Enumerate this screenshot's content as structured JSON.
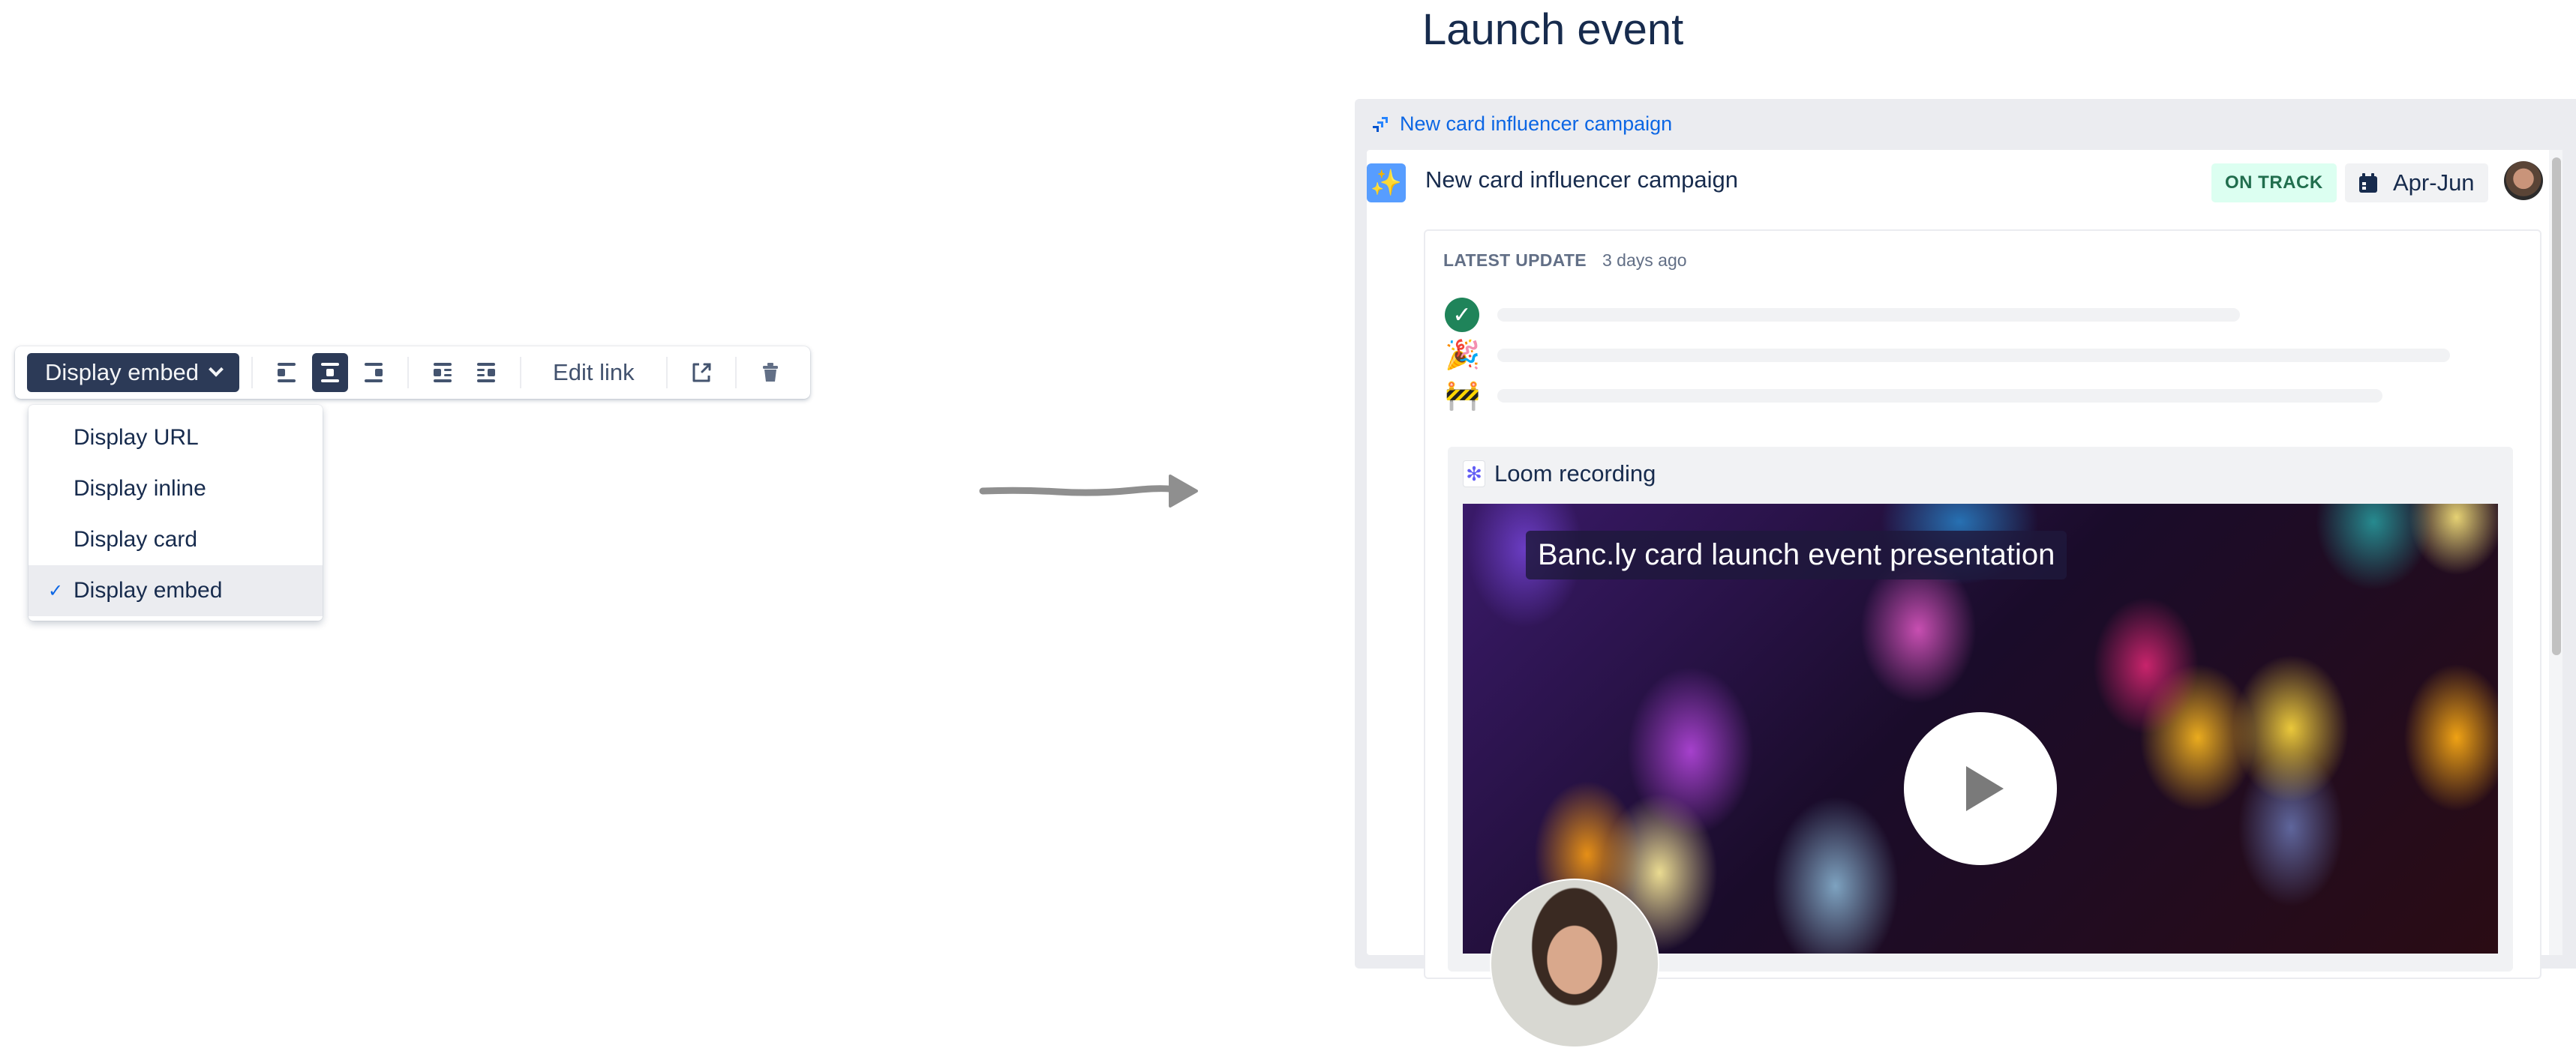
{
  "toolbar": {
    "appearance_label": "Display embed",
    "alignment_buttons": [
      {
        "icon": "align-left-icon",
        "active": false
      },
      {
        "icon": "align-center-icon",
        "active": true
      },
      {
        "icon": "align-right-icon",
        "active": false
      }
    ],
    "wrap_buttons": [
      {
        "icon": "wrap-left-icon"
      },
      {
        "icon": "wrap-right-icon"
      }
    ],
    "edit_link_label": "Edit link",
    "open_icon": "external-link-icon",
    "delete_icon": "trash-icon"
  },
  "dropdown": {
    "items": [
      {
        "label": "Display URL",
        "selected": false
      },
      {
        "label": "Display inline",
        "selected": false
      },
      {
        "label": "Display card",
        "selected": false
      },
      {
        "label": "Display embed",
        "selected": true
      }
    ],
    "check_glyph": "✓"
  },
  "page": {
    "title": "Launch event"
  },
  "embed": {
    "header_link": "New card influencer campaign",
    "project": {
      "icon_glyph": "✨",
      "title": "New card influencer campaign",
      "status": "ON TRACK",
      "date_range": "Apr-Jun",
      "status_color": "#216e4e"
    },
    "update": {
      "label": "LATEST UPDATE",
      "time": "3 days ago",
      "rows": [
        {
          "icon": "check-circle-icon",
          "glyph": "✓"
        },
        {
          "icon": "party-popper-icon",
          "glyph": "🎉"
        },
        {
          "icon": "construction-icon",
          "glyph": "🚧"
        }
      ]
    },
    "loom": {
      "label": "Loom recording",
      "icon_glyph": "✻",
      "video_title": "Banc.ly card launch event presentation"
    }
  }
}
